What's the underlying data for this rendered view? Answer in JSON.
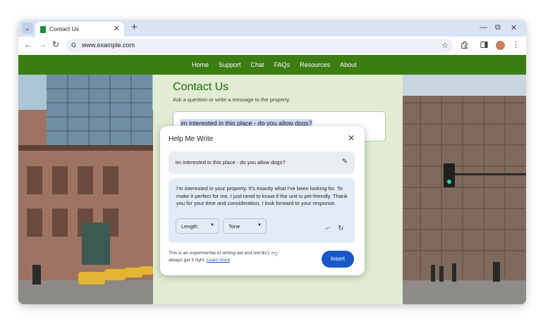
{
  "browser": {
    "tab_title": "Contact Us",
    "url": "www.example.com",
    "omnibox_prefix": "G"
  },
  "nav": {
    "links": [
      "Home",
      "Support",
      "Chat",
      "FAQs",
      "Resources",
      "About"
    ]
  },
  "page": {
    "title": "Contact Us",
    "subtitle": "Ask a question or write a message to the property.",
    "message": "im interested in this place - do you allow dogs?"
  },
  "help_me_write": {
    "title": "Help Me Write",
    "prompt": "im interested in this place - do you allow dogs?",
    "result": "I'm interested in your property. It's exactly what I've been looking for. To make it perfect for me, I just need to know if the unit is pet-friendly. Thank you for your time and consideration. I look forward to your response.",
    "length_label": "Length",
    "tone_label": "Tone",
    "disclaimer": "This is an experimental AI writing aid and won't always get it right.",
    "learn_more": "Learn more",
    "insert_label": "Insert"
  },
  "colors": {
    "nav_green": "#3b7d12",
    "title_green": "#1e6b0a",
    "insert_blue": "#1a58c8"
  }
}
